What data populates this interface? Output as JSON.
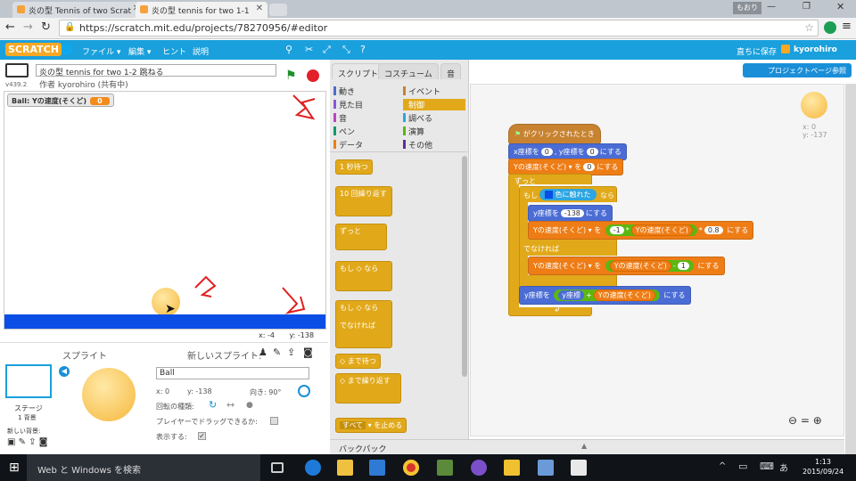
{
  "browser": {
    "tabs": [
      {
        "label": "炎の型 Tennis of two Scrat",
        "active": false
      },
      {
        "label": "炎の型 tennis for two 1-1",
        "active": true
      }
    ],
    "window_user": "もおり",
    "url": "https://scratch.mit.edu/projects/78270956/#editor"
  },
  "menubar": {
    "logo": "SCRATCH",
    "items": [
      "ファイル ▾",
      "編集 ▾",
      "ヒント",
      "説明"
    ],
    "save_now": "直ちに保存",
    "username": "kyorohiro",
    "project_page": "プロジェクトページ参照"
  },
  "project": {
    "version": "v439.2",
    "title": "炎の型 tennis for two 1-2 跳ねる",
    "author": "作者 kyorohiro (共有中)"
  },
  "stage": {
    "variable_label": "Ball: Yの速度(そくど)",
    "variable_value": "0",
    "mouse_x": "x: -4",
    "mouse_y": "y: -138"
  },
  "sprite_pane": {
    "title": "スプライト",
    "new_sprite": "新しいスプライト:",
    "stage_label": "ステージ",
    "backdrops": "1 背景",
    "new_backdrop": "新しい背景:",
    "sprite_name": "Ball",
    "x": "x: 0",
    "y": "y: -138",
    "direction": "向き: 90°",
    "rotation_style": "回転の種類:",
    "draggable": "プレイヤーでドラッグできるか:",
    "show": "表示する:"
  },
  "palette": {
    "tabs": [
      "スクリプト",
      "コスチューム",
      "音"
    ],
    "categories": [
      {
        "label": "動き",
        "color": "#4a6cd4"
      },
      {
        "label": "イベント",
        "color": "#c88330"
      },
      {
        "label": "見た目",
        "color": "#8a55d7"
      },
      {
        "label": "制御",
        "color": "#e1a91a"
      },
      {
        "label": "音",
        "color": "#bb42c3"
      },
      {
        "label": "調べる",
        "color": "#2ca5e2"
      },
      {
        "label": "ペン",
        "color": "#0e9a6c"
      },
      {
        "label": "演算",
        "color": "#5cb712"
      },
      {
        "label": "データ",
        "color": "#ee7d16"
      },
      {
        "label": "その他",
        "color": "#632d99"
      }
    ],
    "blocks": [
      "1 秒待つ",
      "10 回繰り返す",
      "ずっと",
      "もし",
      "なら",
      "でなければ",
      "まで待つ",
      "まで繰り返す",
      "すべて",
      "を止める"
    ]
  },
  "script": {
    "hat": "がクリックされたとき",
    "goto": {
      "label_a": "x座標を",
      "x": "0",
      "label_b": ", y座標を",
      "y": "0",
      "label_c": "にする"
    },
    "set_vy": {
      "var": "Yの速度(そくど) ▾",
      "label": "を",
      "val": "0",
      "end": "にする"
    },
    "forever": "ずっと",
    "if": {
      "label": "もし",
      "touching": "色に触れた",
      "then": "なら"
    },
    "set_y": {
      "label": "y座標を",
      "val": "-138",
      "end": "にする"
    },
    "set_vy2": {
      "var": "Yの速度(そくど) ▾",
      "label": "を",
      "a": "-1",
      "op": "*",
      "b": "Yの速度(そくど)",
      "op2": "*",
      "c": "0.8",
      "end": "にする"
    },
    "else": "でなければ",
    "set_vy3": {
      "var": "Yの速度(そくど) ▾",
      "label": "を",
      "a": "Yの速度(そくど)",
      "op": "-",
      "b": "1",
      "end": "にする"
    },
    "set_y2": {
      "label": "y座標を",
      "a": "y座標",
      "op": "+",
      "b": "Yの速度(そくど)",
      "end": "にする"
    },
    "sprite_x": "x: 0",
    "sprite_y": "y: -137"
  },
  "backpack": "バックパック",
  "taskbar": {
    "search": "Web と Windows を検索",
    "time": "1:13",
    "date": "2015/09/24"
  }
}
